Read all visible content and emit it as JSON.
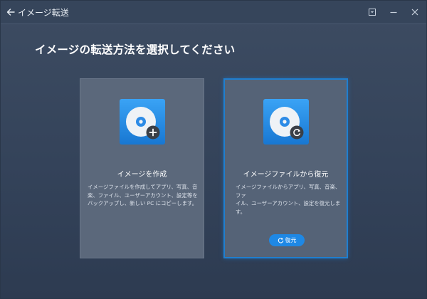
{
  "titlebar": {
    "back_icon": "arrow-left-icon",
    "title": "イメージ転送",
    "controls": [
      "dropdown-icon",
      "minimize-icon",
      "close-icon"
    ]
  },
  "heading": "イメージの転送方法を選択してください",
  "cards": {
    "create": {
      "icon": "disc-plus-icon",
      "title": "イメージを作成",
      "lines": [
        "イメージファイルを作成してアプリ、写真、音",
        "楽、ファイル、ユーザーアカウント、設定等を",
        "バックアップし、新しい PC にコピーします。"
      ]
    },
    "restore": {
      "icon": "disc-restore-icon",
      "title": "イメージファイルから復元",
      "lines": [
        "イメージファイルからアプリ、写真、音楽、ファ",
        "イル、ユーザーアカウント、設定を復元しま",
        "す。"
      ],
      "button_label": "復元"
    }
  },
  "colors": {
    "accent": "#1e88e5",
    "background": "#36455b",
    "card": "#5b687b"
  }
}
